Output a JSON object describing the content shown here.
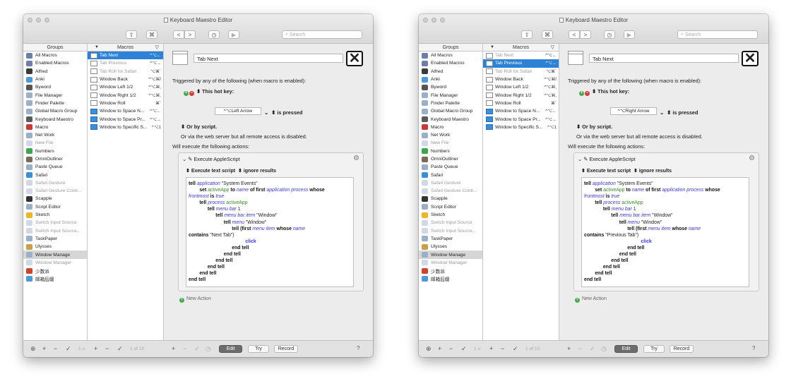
{
  "title": "Keyboard Maestro Editor",
  "toolbar": {
    "share": "⇧",
    "cmd": "⌘",
    "back": "<",
    "forward": ">",
    "history": "◷",
    "play": "▶",
    "search_placeholder": "Search"
  },
  "columns": {
    "groups": "Groups",
    "macros": "Macros"
  },
  "groups": [
    {
      "label": "All Macros",
      "color": "#6b7fa8",
      "dim": false
    },
    {
      "label": "Enabled Macros",
      "color": "#6b7fa8",
      "dim": false
    },
    {
      "label": "Alfred",
      "color": "#3a3a3a",
      "dim": false
    },
    {
      "label": "Anki",
      "color": "#4b9bd8",
      "dim": false
    },
    {
      "label": "Byword",
      "color": "#555555",
      "dim": false
    },
    {
      "label": "File Manager",
      "color": "#9ab0c8",
      "dim": false
    },
    {
      "label": "Finder Palette",
      "color": "#9ab0c8",
      "dim": false
    },
    {
      "label": "Global Macro Group",
      "color": "#9ab0c8",
      "dim": false
    },
    {
      "label": "Keyboard Maestro",
      "color": "#5b5b5b",
      "dim": false
    },
    {
      "label": "Macro",
      "color": "#c83a3a",
      "dim": false
    },
    {
      "label": "Net Work",
      "color": "#9ab0c8",
      "dim": false
    },
    {
      "label": "New File",
      "color": "#cfd8e4",
      "dim": true
    },
    {
      "label": "Numbers",
      "color": "#3aa84a",
      "dim": false
    },
    {
      "label": "OmniOutliner",
      "color": "#7a6a5a",
      "dim": false
    },
    {
      "label": "Paste Queue",
      "color": "#9ab0c8",
      "dim": false
    },
    {
      "label": "Safari",
      "color": "#3b8fd8",
      "dim": false
    },
    {
      "label": "Safari Gesture",
      "color": "#cfd8e4",
      "dim": true
    },
    {
      "label": "Safari Gesture Contr...",
      "color": "#cfd8e4",
      "dim": true
    },
    {
      "label": "Scapple",
      "color": "#333333",
      "dim": false
    },
    {
      "label": "Script Editor",
      "color": "#9ab0c8",
      "dim": false
    },
    {
      "label": "Sketch",
      "color": "#f0b429",
      "dim": false
    },
    {
      "label": "Switch Input Source",
      "color": "#cfd8e4",
      "dim": true
    },
    {
      "label": "Switch Input Source...",
      "color": "#cfd8e4",
      "dim": true
    },
    {
      "label": "TaskPaper",
      "color": "#9ab0c8",
      "dim": false
    },
    {
      "label": "Ulysses",
      "color": "#c8a04a",
      "dim": false
    },
    {
      "label": "Window Manage",
      "color": "#9ab0c8",
      "dim": false
    },
    {
      "label": "Window Manager",
      "color": "#cfd8e4",
      "dim": true
    },
    {
      "label": "少数派",
      "color": "#d0432a",
      "dim": false
    },
    {
      "label": "邮箱后缀",
      "color": "#4b9bd8",
      "dim": false
    }
  ],
  "selected_group": "Window Manage",
  "macros": [
    {
      "label": "Tab Next",
      "hotkey": "^⌥←",
      "blue": false
    },
    {
      "label": "Tab Previous",
      "hotkey": "^⌥→",
      "blue": false
    },
    {
      "label": "Tab Roll for Safari",
      "hotkey": "⌥⌘`",
      "blue": false
    },
    {
      "label": "Window Back",
      "hotkey": "^⌥⌘/",
      "blue": false
    },
    {
      "label": "Window Left 1/2",
      "hotkey": "^⌥⌘,",
      "blue": false
    },
    {
      "label": "Window Right 1/2",
      "hotkey": "^⌥⌘.",
      "blue": false
    },
    {
      "label": "Window Roll",
      "hotkey": "⌘`",
      "blue": false
    },
    {
      "label": "Window to Space N...",
      "hotkey": "^⌥←",
      "blue": true
    },
    {
      "label": "Window to Space Pr...",
      "hotkey": "^⌥→",
      "blue": true
    },
    {
      "label": "Window to Specific S...",
      "hotkey": "^⌥1",
      "blue": true
    }
  ],
  "bottom": {
    "groups_count": "1 o",
    "macros_count": "1 of 10",
    "edit": "Edit",
    "try": "Try",
    "record": "Record",
    "help": "?"
  },
  "common": {
    "triggered": "Triggered by any of the following (when macro is enabled):",
    "this_hot_key": "This hot key:",
    "is_pressed": "is pressed",
    "or_by_script": "Or by script.",
    "web_server": "Or via the web server but all remote access is disabled.",
    "will_execute": "Will execute the following actions:",
    "action_title": "Execute AppleScript",
    "exec_text": "Execute text script",
    "ignore_results": "ignore results",
    "new_action": "New Action"
  },
  "editors": [
    {
      "selected_macro_index": 0,
      "macro_name": "Tab Next",
      "hotkey": "^⌥Left Arrow",
      "menu_item": "Next Tab"
    },
    {
      "selected_macro_index": 1,
      "macro_name": "Tab Next",
      "hotkey": "^⌥Right Arrow",
      "menu_item": "Previous Tab"
    }
  ],
  "script": {
    "w_tell": "tell",
    "w_application": "application",
    "s_system_events": "\"System Events\"",
    "w_set": "set",
    "v_activeApp": "activeApp",
    "w_to": "to",
    "w_name": "name",
    "w_of_first": "of first",
    "w_application_process": "application process",
    "w_whose": "whose",
    "w_frontmost": "frontmost",
    "w_is": "is",
    "w_true": "true",
    "w_process": "process",
    "w_menu_bar": "menu bar",
    "n_1": "1",
    "w_menu_bar_item": "menu bar item",
    "s_window": "\"Window\"",
    "w_menu": "menu",
    "w_tell_first": "tell (first",
    "w_menu_item": "menu item",
    "w_contains": "contains",
    "w_click": "click",
    "w_end_tell": "end tell"
  }
}
